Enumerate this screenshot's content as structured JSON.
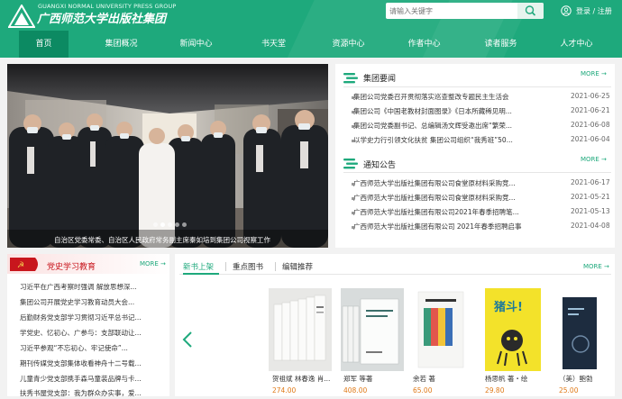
{
  "header": {
    "logo_en": "GUANGXI NORMAL UNIVERSITY PRESS GROUP",
    "logo_cn": "广西师范大学出版社集团",
    "search_placeholder": "请输入关键字",
    "user_links": "登录 / 注册"
  },
  "nav": [
    {
      "label": "首页",
      "active": true
    },
    {
      "label": "集团概况"
    },
    {
      "label": "新闻中心"
    },
    {
      "label": "书天堂"
    },
    {
      "label": "资源中心"
    },
    {
      "label": "作者中心"
    },
    {
      "label": "读者服务"
    },
    {
      "label": "人才中心"
    }
  ],
  "hero": {
    "caption": "自治区党委常委、自治区人民政府常务副主席秦如培到集团公司视察工作",
    "slide_count": 5,
    "active_slide": 1
  },
  "group_news": {
    "title": "集团要闻",
    "more": "MORE →",
    "items": [
      {
        "text": "集团公司党委召开贯彻落实巡查整改专题民主生活会",
        "date": "2021-06-25"
      },
      {
        "text": "集团公司《中国老教材封面图录》《日本所藏稀见明...",
        "date": "2021-06-21"
      },
      {
        "text": "集团公司党委副书记、总编辑汤文辉受邀出席“繁荣...",
        "date": "2021-06-08"
      },
      {
        "text": "以学史力行引领文化扶贫 集团公司组织“我秀班”50...",
        "date": "2021-06-04"
      }
    ]
  },
  "notices": {
    "title": "通知公告",
    "more": "MORE →",
    "items": [
      {
        "text": "广西师范大学出版社集团有限公司食堂原材料采购竞...",
        "date": "2021-06-17"
      },
      {
        "text": "广西师范大学出版社集团有限公司食堂原材料采购竞...",
        "date": "2021-05-21"
      },
      {
        "text": "广西师范大学出版社集团有限公司2021年春季招聘笔...",
        "date": "2021-05-13"
      },
      {
        "text": "广西师范大学出版社集团有限公司 2021年春季招聘启事",
        "date": "2021-04-08"
      }
    ]
  },
  "party": {
    "title": "党史学习教育",
    "more": "MORE →",
    "items": [
      "习近平在广西考察时强调 解放思想深...",
      "集团公司开展党史学习教育动员大会...",
      "后勤财务党支部学习贯彻习近平总书记...",
      "学党史、忆初心、广参与：支部联动让...",
      "习近平参观“不忘初心、牢记使命”...",
      "期刊传媒党支部集体收看神舟十二号载...",
      "儿童青少党支部携手森马童装品牌与卡...",
      "扶秀书屋党支部：我为群众办实事，爱..."
    ]
  },
  "books": {
    "tabs": [
      "新书上架",
      "重点图书",
      "编辑推荐"
    ],
    "active_tab": 0,
    "more": "MORE →",
    "items": [
      {
        "author": "贺祖斌 林春逸 肖...",
        "price": "274.00",
        "cover": "#e8e8e6"
      },
      {
        "author": "郑军 等著",
        "price": "408.00",
        "cover": "#d8dcdc"
      },
      {
        "author": "余若 著",
        "price": "65.00",
        "cover": "#f6f6f4"
      },
      {
        "author": "杨思帆 著・绘",
        "price": "29.80",
        "cover": "#f3e22a",
        "cover_text": "猪斗!"
      },
      {
        "author": "（美）鲍勃",
        "price": "25.00",
        "cover": "#1d2c3f"
      }
    ]
  },
  "colors": {
    "brand": "#1ea97c",
    "brand_dark": "#0c8a62",
    "party_red": "#c8161d",
    "price": "#e07a18"
  }
}
